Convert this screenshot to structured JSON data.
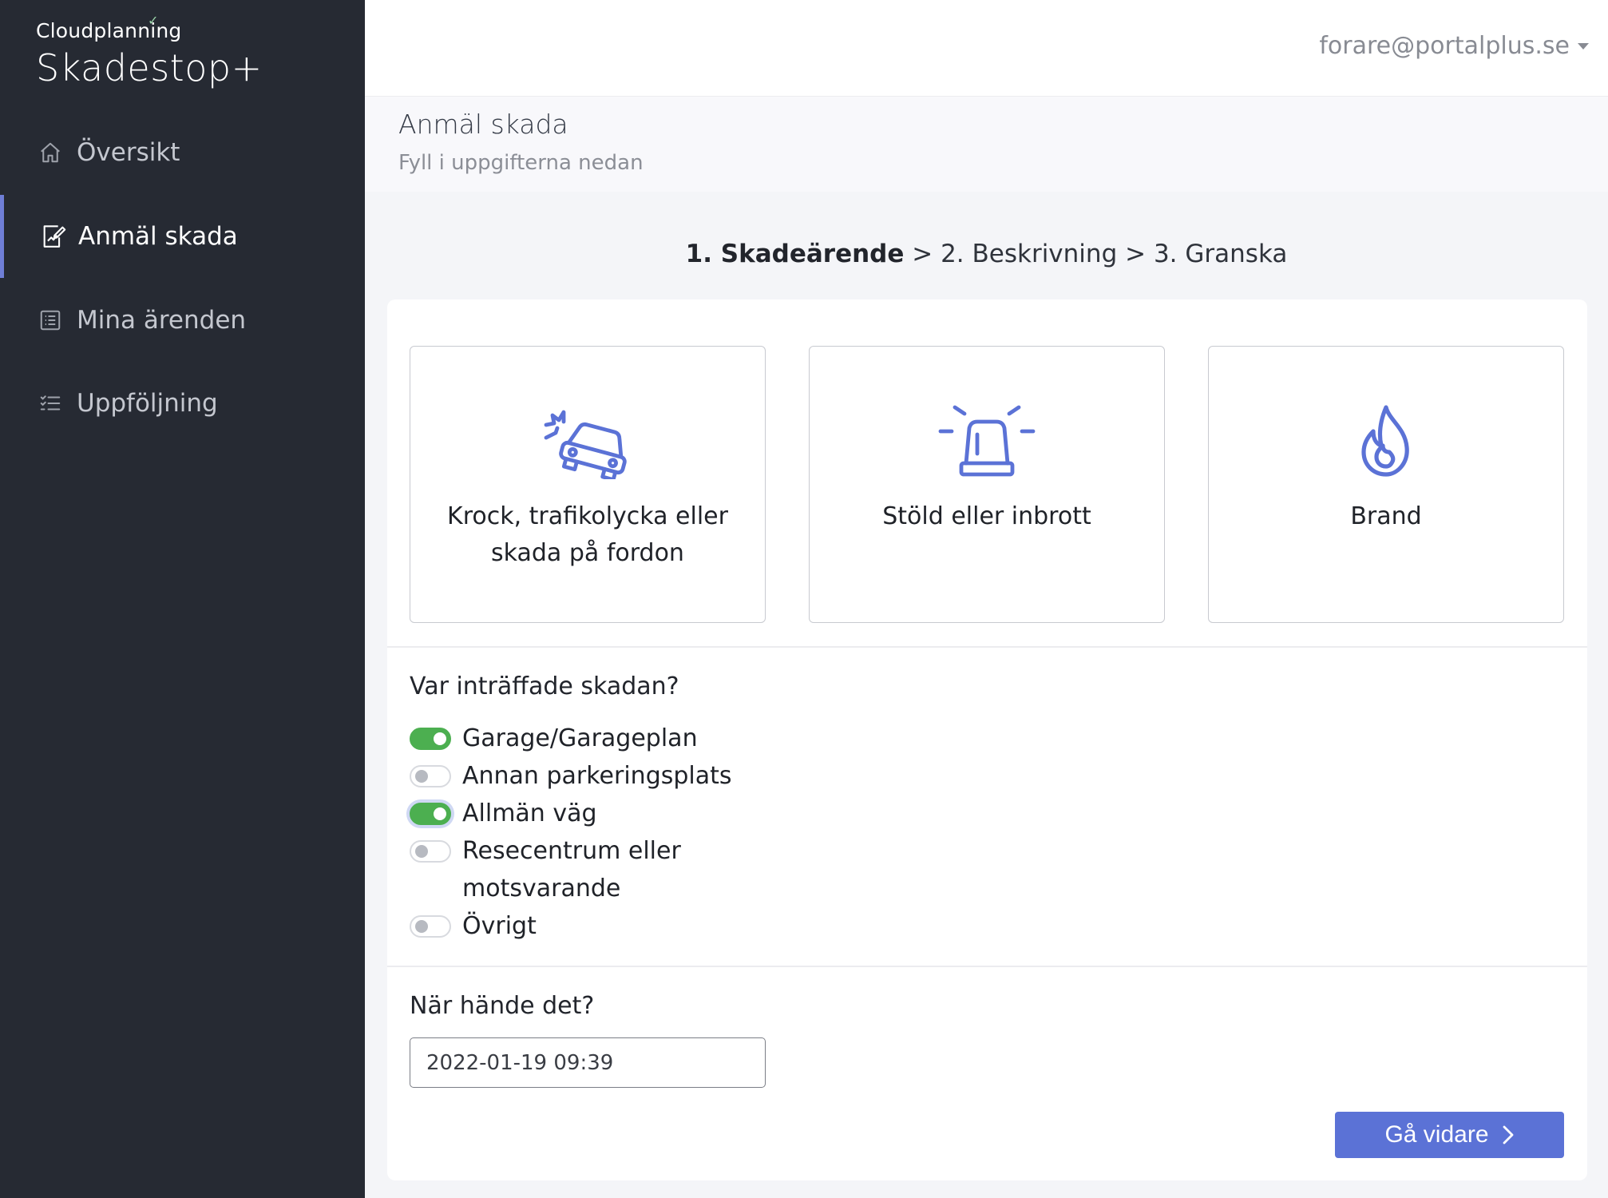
{
  "brand": {
    "company": "Cloudplanning",
    "product": "Skadestop+"
  },
  "sidebar": {
    "items": [
      {
        "label": "Översikt",
        "icon": "home-icon",
        "active": false
      },
      {
        "label": "Anmäl skada",
        "icon": "report-edit-icon",
        "active": true
      },
      {
        "label": "Mina ärenden",
        "icon": "list-icon",
        "active": false
      },
      {
        "label": "Uppföljning",
        "icon": "checklist-icon",
        "active": false
      }
    ]
  },
  "header": {
    "user": "forare@portalplus.se"
  },
  "page": {
    "title": "Anmäl skada",
    "subtitle": "Fyll i uppgifterna nedan"
  },
  "steps": {
    "step1": "1. Skadeärende",
    "sep1": ">",
    "step2": "2. Beskrivning",
    "sep2": ">",
    "step3": "3. Granska"
  },
  "damage_types": [
    {
      "label": "Krock, trafikolycka eller skada på fordon",
      "icon": "car-crash-icon"
    },
    {
      "label": "Stöld eller inbrott",
      "icon": "siren-icon"
    },
    {
      "label": "Brand",
      "icon": "flame-icon"
    }
  ],
  "location": {
    "question": "Var inträffade skadan?",
    "options": [
      {
        "label": "Garage/Garageplan",
        "checked": true
      },
      {
        "label": "Annan parkeringsplats",
        "checked": false
      },
      {
        "label": "Allmän väg",
        "checked": true
      },
      {
        "label": "Resecentrum eller motsvarande",
        "checked": false
      },
      {
        "label": "Övrigt",
        "checked": false
      }
    ]
  },
  "when": {
    "question": "När hände det?",
    "value": "2022-01-19 09:39"
  },
  "actions": {
    "next_label": "Gå vidare"
  },
  "colors": {
    "sidebar_bg": "#262a33",
    "accent": "#5b72d6",
    "toggle_on": "#4caf50",
    "icon": "#5b72d6"
  }
}
